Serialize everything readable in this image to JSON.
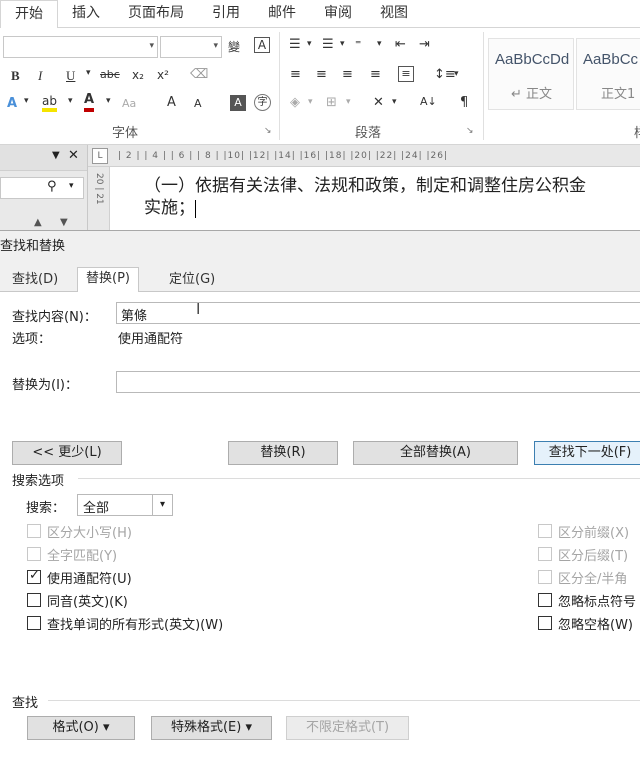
{
  "ribbon_tabs": [
    "开始",
    "插入",
    "页面布局",
    "引用",
    "邮件",
    "审阅",
    "视图"
  ],
  "ribbon": {
    "font_group_label": "字体",
    "paragraph_group_label": "段落",
    "styles_group_label_partial": "样",
    "styles": [
      {
        "sample": "AaBbCcDd",
        "name": "↵ 正文"
      },
      {
        "sample": "AaBbCc",
        "name": "正文1"
      }
    ],
    "font_buttons": {
      "bold": "B",
      "italic": "I",
      "underline": "U",
      "strike": "abc",
      "sub": "x₂",
      "sup": "x²",
      "grow": "A",
      "shrink": "A",
      "aa": "Aa"
    }
  },
  "document": {
    "ruler_marks": "| 2 |  | 4 |  | 6 |  | 8 |  |10|  |12|  |14|  |16|  |18|  |20|  |22|  |24|  |26|",
    "vruler_marks": "20 | 21",
    "line1": "（一）依据有关法律、法规和政策，制定和调整住房公积金",
    "line2": "实施；"
  },
  "dialog": {
    "title": "查找和替换",
    "tabs": [
      "查找(D)",
      "替换(P)",
      "定位(G)"
    ],
    "active_tab": 1,
    "find_label": "查找内容(N)：",
    "find_value": "第條",
    "options_label": "选项：",
    "options_value": "使用通配符",
    "replace_label": "替换为(I)：",
    "replace_value": "",
    "buttons": {
      "less": "<< 更少(L)",
      "replace": "替换(R)",
      "replace_all": "全部替换(A)",
      "find_next": "查找下一处(F)"
    },
    "search_options_label": "搜索选项",
    "search_label": "搜索：",
    "search_value": "全部",
    "left_options": [
      {
        "label": "区分大小写(H)",
        "checked": false,
        "disabled": true
      },
      {
        "label": "全字匹配(Y)",
        "checked": false,
        "disabled": true
      },
      {
        "label": "使用通配符(U)",
        "checked": true,
        "disabled": false
      },
      {
        "label": "同音(英文)(K)",
        "checked": false,
        "disabled": false
      },
      {
        "label": "查找单词的所有形式(英文)(W)",
        "checked": false,
        "disabled": false
      }
    ],
    "right_options": [
      {
        "label": "区分前缀(X)",
        "checked": false,
        "disabled": true
      },
      {
        "label": "区分后缀(T)",
        "checked": false,
        "disabled": true
      },
      {
        "label": "区分全/半角",
        "checked": false,
        "disabled": true
      },
      {
        "label": "忽略标点符号",
        "checked": false,
        "disabled": false
      },
      {
        "label": "忽略空格(W)",
        "checked": false,
        "disabled": false
      }
    ],
    "find_section_label": "查找",
    "bottom_buttons": {
      "format": "格式(O) ▾",
      "special": "特殊格式(E) ▾",
      "no_format": "不限定格式(T)"
    }
  }
}
